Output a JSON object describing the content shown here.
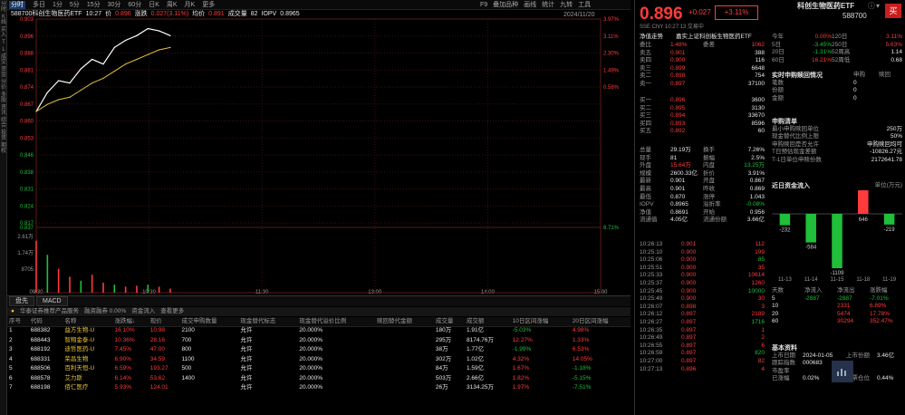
{
  "toolbar": {
    "tabs": [
      "分时",
      "多日",
      "1分",
      "5分",
      "15分",
      "30分",
      "60分",
      "日K",
      "周K",
      "月K",
      "更多"
    ],
    "active": "分时",
    "right": [
      "F9",
      "叠加品种",
      "画线",
      "统计",
      "九转",
      "工具"
    ]
  },
  "left_toolbar": [
    "分时",
    "K线",
    "买入",
    "T",
    "L",
    "成交",
    "资金",
    "分价",
    "多股",
    "资讯",
    "综合",
    "投资",
    "期权"
  ],
  "chart": {
    "header": {
      "name": "588700科创生物医药ETF",
      "time": "10:27",
      "price_label": "价",
      "price": "0.896",
      "chg_label": "涨跌",
      "chg": "0.027(3.11%)",
      "avg_label": "均价",
      "avg": "0.891",
      "vol_label": "成交量",
      "vol": "82",
      "iopv_label": "IOPV",
      "iopv": "0.8965"
    },
    "date": "2024/11/20",
    "left_axis": [
      "0.903",
      "0.896",
      "0.888",
      "0.881",
      "0.874",
      "0.867",
      "0.860",
      "0.853",
      "0.846",
      "0.838",
      "0.831",
      "0.824",
      "0.817"
    ],
    "right_axis": [
      "3.97%",
      "3.11%",
      "2.30%",
      "1.49%",
      "0.58%",
      "",
      "",
      "",
      "",
      "",
      "",
      "",
      ""
    ],
    "vol_axis_left": [
      "2.61万",
      "1.74万",
      "8705"
    ],
    "vol_axis_right": [
      "",
      "",
      ""
    ],
    "vol_marker": "0.837",
    "vol_marker_r": "8.71%",
    "x_ticks": [
      "09:30",
      "10:30",
      "11:30",
      "13:00",
      "14:00",
      "15:00"
    ]
  },
  "chart_data": {
    "type": "line",
    "title": "588700科创生物医药ETF",
    "x": [
      "09:30",
      "09:35",
      "09:40",
      "09:45",
      "09:50",
      "09:55",
      "10:00",
      "10:05",
      "10:10",
      "10:15",
      "10:20",
      "10:25",
      "10:27"
    ],
    "series": [
      {
        "name": "价",
        "values": [
          0.864,
          0.872,
          0.877,
          0.876,
          0.882,
          0.886,
          0.884,
          0.891,
          0.894,
          0.896,
          0.899,
          0.898,
          0.896
        ]
      },
      {
        "name": "均价",
        "values": [
          0.864,
          0.867,
          0.869,
          0.87,
          0.873,
          0.876,
          0.878,
          0.881,
          0.884,
          0.886,
          0.888,
          0.89,
          0.891
        ]
      }
    ],
    "volume": [
      2.6,
      1.9,
      1.2,
      0.8,
      0.6,
      0.9,
      0.5,
      0.4,
      0.3,
      0.35,
      0.4,
      0.3,
      0.2
    ],
    "ylim": [
      0.817,
      0.903
    ]
  },
  "bottom_tabs": [
    "盘先",
    "MACD"
  ],
  "info": {
    "text": "华泰证券推荐产品服务",
    "net": "融资融券 0.00%",
    "inflow": "资金流入",
    "more": "查看更多"
  },
  "table": {
    "headers": [
      "序号",
      "代码",
      "名称",
      "涨跌幅↓",
      "现价",
      "成交申购数量",
      "现金替代标志",
      "现金替代溢价比例",
      "赎回替代金额",
      "成交量",
      "成交额",
      "10日区间涨幅",
      "20日区间涨幅"
    ],
    "rows": [
      [
        "1",
        "688382",
        "益方生物-U",
        "16.10%",
        "10.98",
        "2100",
        "允许",
        "20.000%",
        "",
        "180万",
        "1.91亿",
        "-5.03%",
        "4.98%"
      ],
      [
        "2",
        "688443",
        "智翔金泰-U",
        "10.36%",
        "28.16",
        "700",
        "允许",
        "20.000%",
        "",
        "295万",
        "8174.76万",
        "12.27%",
        "1.33%"
      ],
      [
        "3",
        "688192",
        "迪哲医药-U",
        "7.45%",
        "47.00",
        "800",
        "允许",
        "20.000%",
        "",
        "38万",
        "1.77亿",
        "-1.99%",
        "6.53%"
      ],
      [
        "4",
        "688331",
        "荣昌生物",
        "6.90%",
        "34.59",
        "1100",
        "允许",
        "20.000%",
        "",
        "302万",
        "1.02亿",
        "4.32%",
        "14.05%"
      ],
      [
        "5",
        "688506",
        "百利天恒-U",
        "6.59%",
        "193.27",
        "500",
        "允许",
        "20.000%",
        "",
        "84万",
        "1.59亿",
        "1.67%",
        "-1.18%"
      ],
      [
        "6",
        "688578",
        "艾力斯",
        "6.14%",
        "53.62",
        "1400",
        "允许",
        "20.000%",
        "",
        "503万",
        "2.66亿",
        "1.82%",
        "-5.15%"
      ],
      [
        "7",
        "688198",
        "佰仁医疗",
        "5.93%",
        "124.01",
        "",
        "允许",
        "20.000%",
        "",
        "26万",
        "3134.25万",
        "1.97%",
        "-7.51%"
      ]
    ]
  },
  "quote": {
    "price": "0.896",
    "chg": "+0.027",
    "pct": "+3.11%",
    "name": "科创生物医药ETF",
    "code": "588700",
    "buy": "买",
    "sub": "SSE  CNY  10:27:13  交易中"
  },
  "ob_top": {
    "label": "净值走势",
    "name": "嘉实上证科创板生物医药ETF"
  },
  "orders_sell": [
    [
      "委比",
      "1.48%",
      "委差",
      "1062"
    ],
    [
      "卖五",
      "0.901",
      "",
      "388"
    ],
    [
      "卖四",
      "0.900",
      "",
      "116"
    ],
    [
      "卖三",
      "0.899",
      "",
      "6648"
    ],
    [
      "卖二",
      "0.898",
      "",
      "754"
    ],
    [
      "卖一",
      "0.897",
      "",
      "37100"
    ]
  ],
  "orders_buy": [
    [
      "买一",
      "0.896",
      "",
      "3600"
    ],
    [
      "买二",
      "0.895",
      "",
      "3130"
    ],
    [
      "买三",
      "0.894",
      "",
      "33670"
    ],
    [
      "买四",
      "0.893",
      "",
      "8596"
    ],
    [
      "买五",
      "0.892",
      "",
      "60"
    ]
  ],
  "stats": [
    [
      "总量",
      "29.19万",
      "换手",
      "7.26%"
    ],
    [
      "现手",
      "81",
      "振幅",
      "2.5%"
    ],
    [
      "外盘",
      "15.64万",
      "内盘",
      "13.25万"
    ],
    [
      "规模",
      "2600.33亿",
      "折价",
      "3.91%"
    ],
    [
      "最新",
      "0.901",
      "开盘",
      "0.867"
    ],
    [
      "最高",
      "0.901",
      "昨收",
      "0.869"
    ],
    [
      "最低",
      "0.870",
      "涨停",
      "1.043"
    ],
    [
      "IOPV",
      "0.8965",
      "溢折率",
      "-0.08%"
    ],
    [
      "净值",
      "0.8691",
      "开始",
      "0.956"
    ],
    [
      "流通值",
      "4.05亿",
      "流通份额",
      "3.66亿"
    ]
  ],
  "ticks": [
    [
      "10:26:13",
      "0.901",
      "112"
    ],
    [
      "10:25:10",
      "0.900",
      "199"
    ],
    [
      "10:25:06",
      "0.900",
      "85"
    ],
    [
      "10:25:51",
      "0.900",
      "35"
    ],
    [
      "10:25:33",
      "0.900",
      "10614"
    ],
    [
      "10:25:37",
      "0.900",
      "1260"
    ],
    [
      "10:25:45",
      "0.900",
      "10000"
    ],
    [
      "10:25:49",
      "0.900",
      "30"
    ],
    [
      "10:26:07",
      "0.898",
      "3"
    ],
    [
      "10:26:12",
      "0.897",
      "2189"
    ],
    [
      "10:26:27",
      "0.897",
      "1716"
    ],
    [
      "10:26:35",
      "0.897",
      "1"
    ],
    [
      "10:26:49",
      "0.897",
      "2"
    ],
    [
      "10:26:55",
      "0.897",
      "6"
    ],
    [
      "10:26:59",
      "0.897",
      "820"
    ],
    [
      "10:27:00",
      "0.897",
      "82"
    ],
    [
      "10:27:13",
      "0.896",
      "4"
    ]
  ],
  "perf": [
    [
      "今年",
      "0.00%",
      "120日",
      "3.11%"
    ],
    [
      "5日",
      "-3.45%",
      "250日",
      "5.63%"
    ],
    [
      "20日",
      "-1.31%",
      "52周高",
      "1.14"
    ],
    [
      "60日",
      "16.21%",
      "52周低",
      "0.68"
    ]
  ],
  "rt": {
    "title": "实时申购赎回情况",
    "col1": "申购",
    "col2": "赎回",
    "rows": [
      "笔数",
      "份额",
      "金额"
    ],
    "vals": [
      "0",
      "0",
      "0"
    ]
  },
  "dlist": {
    "title": "申购清单",
    "rows": [
      [
        "最小申购赎回单位",
        "250万"
      ],
      [
        "现金替代比例上限",
        "50%"
      ],
      [
        "申购赎回是否允许",
        "申购赎回均可"
      ],
      [
        "T日预估现金差额",
        "-10826.27元"
      ],
      [
        "T-1日单位申赎份数",
        "2172641.78"
      ]
    ]
  },
  "flow": {
    "title": "近日资金流入",
    "unit": "单位(万元)",
    "vals": [
      -232,
      -584,
      -1109,
      646,
      -219
    ],
    "dates": [
      "11-13",
      "11-14",
      "11-15",
      "11-18",
      "11-19"
    ]
  },
  "fund_table": {
    "hdr": [
      "天数",
      "净流入",
      "净流出",
      "涨跌幅"
    ],
    "rows": [
      [
        "5",
        "-2887",
        "-2887",
        "-7.01%"
      ],
      [
        "10",
        "",
        "2331",
        "6.89%"
      ],
      [
        "20",
        "",
        "5474",
        "17.78%"
      ],
      [
        "60",
        "",
        "30294",
        "352.47%"
      ]
    ]
  },
  "basic": {
    "title": "基本资料",
    "r1": [
      "上市日期",
      "2024-01-05",
      "上市份额",
      "3.46亿"
    ],
    "r2": [
      "跟踪指数",
      "000683",
      "",
      ""
    ],
    "r3": [
      "市盈率",
      "",
      "",
      ""
    ],
    "r4": [
      "已涨幅",
      "0.02%",
      "股票仓位",
      "0.44%"
    ]
  }
}
